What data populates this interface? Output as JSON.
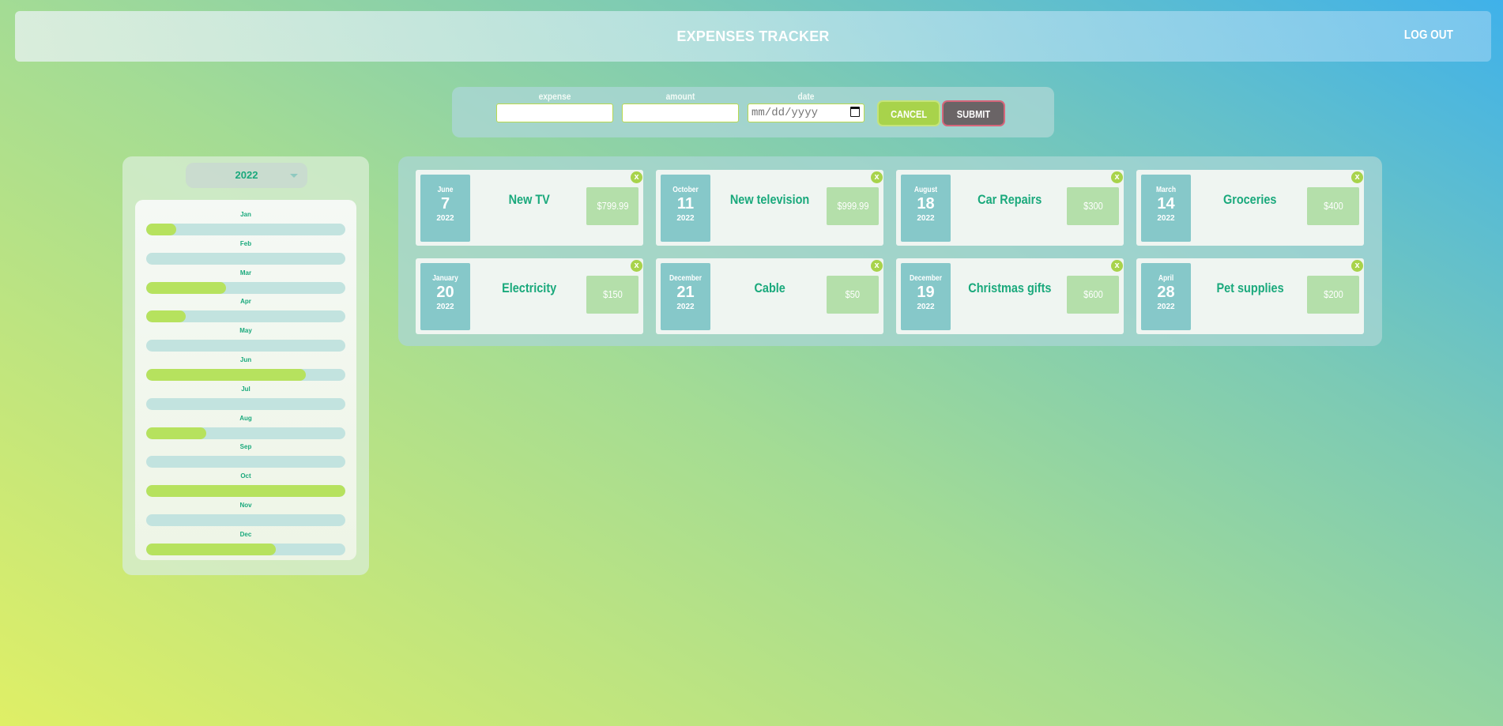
{
  "header": {
    "title": "EXPENSES TRACKER",
    "logout_label": "LOG OUT"
  },
  "form": {
    "expense_label": "expense",
    "amount_label": "amount",
    "date_label": "date",
    "date_placeholder": "mm/dd/yyyy",
    "cancel_label": "CANCEL",
    "submit_label": "SUBMIT"
  },
  "sidebar": {
    "selected_year": "2022",
    "months": [
      {
        "label": "Jan",
        "fill_fraction": 0.15
      },
      {
        "label": "Feb",
        "fill_fraction": 0.0
      },
      {
        "label": "Mar",
        "fill_fraction": 0.4
      },
      {
        "label": "Apr",
        "fill_fraction": 0.2
      },
      {
        "label": "May",
        "fill_fraction": 0.0
      },
      {
        "label": "Jun",
        "fill_fraction": 0.8
      },
      {
        "label": "Jul",
        "fill_fraction": 0.0
      },
      {
        "label": "Aug",
        "fill_fraction": 0.3
      },
      {
        "label": "Sep",
        "fill_fraction": 0.0
      },
      {
        "label": "Oct",
        "fill_fraction": 1.0
      },
      {
        "label": "Nov",
        "fill_fraction": 0.0
      },
      {
        "label": "Dec",
        "fill_fraction": 0.65
      }
    ]
  },
  "expenses": [
    {
      "month": "June",
      "day": "7",
      "year": "2022",
      "name": "New TV",
      "amount": "$799.99"
    },
    {
      "month": "October",
      "day": "11",
      "year": "2022",
      "name": "New television",
      "amount": "$999.99"
    },
    {
      "month": "August",
      "day": "18",
      "year": "2022",
      "name": "Car Repairs",
      "amount": "$300"
    },
    {
      "month": "March",
      "day": "14",
      "year": "2022",
      "name": "Groceries",
      "amount": "$400"
    },
    {
      "month": "January",
      "day": "20",
      "year": "2022",
      "name": "Electricity",
      "amount": "$150"
    },
    {
      "month": "December",
      "day": "21",
      "year": "2022",
      "name": "Cable",
      "amount": "$50"
    },
    {
      "month": "December",
      "day": "19",
      "year": "2022",
      "name": "Christmas gifts",
      "amount": "$600"
    },
    {
      "month": "April",
      "day": "28",
      "year": "2022",
      "name": "Pet supplies",
      "amount": "$200"
    }
  ],
  "close_glyph": "x"
}
